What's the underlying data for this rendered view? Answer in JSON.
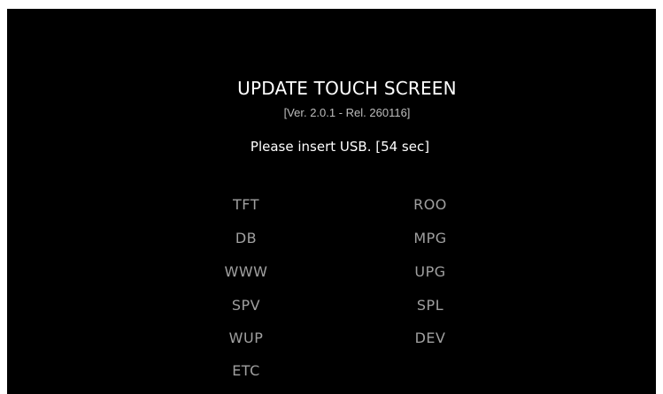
{
  "header": {
    "title": "UPDATE TOUCH SCREEN",
    "version": "[Ver. 2.0.1 - Rel. 260116]",
    "status": "Please insert USB. [54 sec]"
  },
  "options": {
    "left": [
      "TFT",
      "DB",
      "WWW",
      "SPV",
      "WUP",
      "ETC"
    ],
    "right": [
      "ROO",
      "MPG",
      "UPG",
      "SPL",
      "DEV"
    ]
  },
  "colors": {
    "background": "#000000",
    "title": "#ffffff",
    "version": "#bdbdbd",
    "option": "#a0a0a0"
  }
}
